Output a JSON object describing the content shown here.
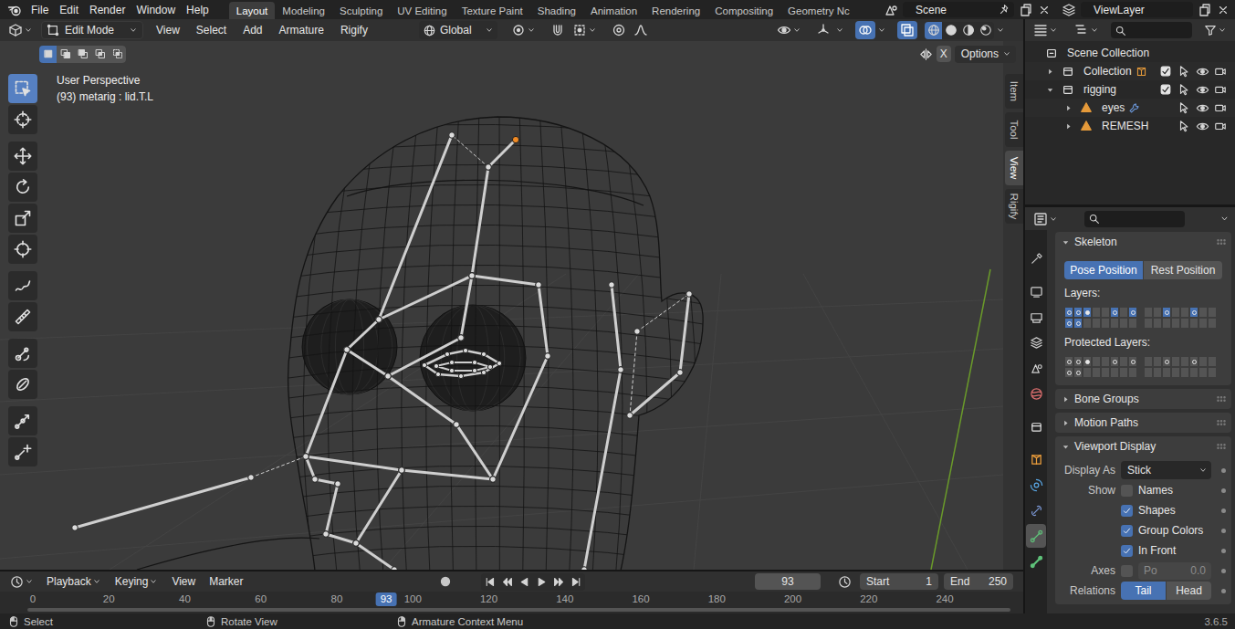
{
  "top_bar": {
    "menus": [
      "File",
      "Edit",
      "Render",
      "Window",
      "Help"
    ],
    "workspaces": [
      {
        "label": "Layout",
        "selected": true
      },
      {
        "label": "Modeling",
        "selected": false
      },
      {
        "label": "Sculpting",
        "selected": false
      },
      {
        "label": "UV Editing",
        "selected": false
      },
      {
        "label": "Texture Paint",
        "selected": false
      },
      {
        "label": "Shading",
        "selected": false
      },
      {
        "label": "Animation",
        "selected": false
      },
      {
        "label": "Rendering",
        "selected": false
      },
      {
        "label": "Compositing",
        "selected": false
      },
      {
        "label": "Geometry Nc",
        "selected": false
      }
    ],
    "scene": "Scene",
    "view_layer": "ViewLayer"
  },
  "viewport": {
    "mode": "Edit Mode",
    "menus": [
      "View",
      "Select",
      "Add",
      "Armature",
      "Rigify"
    ],
    "orientation": "Global",
    "snap": false,
    "proportional": false,
    "gizmos": false,
    "overlays": true,
    "xray": true,
    "shading": [
      {
        "kind": "wireframe",
        "selected": true
      },
      {
        "kind": "solid",
        "selected": false
      },
      {
        "kind": "material",
        "selected": false
      },
      {
        "kind": "rendered",
        "selected": false
      }
    ],
    "select_modes": [
      {
        "kind": "set",
        "selected": true
      },
      {
        "kind": "extend",
        "selected": false
      },
      {
        "kind": "subtract",
        "selected": false
      },
      {
        "kind": "difference",
        "selected": false
      },
      {
        "kind": "intersect",
        "selected": false
      }
    ],
    "mirror_axis": {
      "label": "X",
      "on": false
    },
    "options": "Options",
    "info": [
      "User Perspective",
      "(93) metarig : lid.T.L"
    ],
    "tools": [
      [
        {
          "kind": "select",
          "selected": true
        },
        {
          "kind": "cursor",
          "selected": false
        }
      ],
      [
        {
          "kind": "move",
          "selected": false
        },
        {
          "kind": "rotate",
          "selected": false
        },
        {
          "kind": "scale",
          "selected": false
        },
        {
          "kind": "transform",
          "selected": false
        }
      ],
      [
        {
          "kind": "annotate",
          "selected": false
        },
        {
          "kind": "measure",
          "selected": false
        }
      ],
      [
        {
          "kind": "roll",
          "selected": false
        },
        {
          "kind": "envelope",
          "selected": false
        }
      ],
      [
        {
          "kind": "extrude",
          "selected": false
        },
        {
          "kind": "extrudecursor",
          "selected": false
        }
      ]
    ],
    "side_tabs": [
      {
        "label": "Item",
        "selected": false
      },
      {
        "label": "Tool",
        "selected": false
      },
      {
        "label": "View",
        "selected": true
      },
      {
        "label": "Rigify",
        "selected": false
      }
    ]
  },
  "outliner": {
    "items": [
      {
        "label": "Scene Collection",
        "depth": 0,
        "kind": "scenecollection",
        "expandable": false
      },
      {
        "label": "Collection",
        "depth": 1,
        "kind": "collection",
        "expandable": true,
        "expanded": false,
        "checked": true,
        "selectable": true,
        "visible": true,
        "renderable": true,
        "child_kind": "object"
      },
      {
        "label": "rigging",
        "depth": 1,
        "kind": "collection",
        "expandable": true,
        "expanded": true,
        "checked": true,
        "selectable": true,
        "visible": true,
        "renderable": true,
        "child_kind": "none"
      },
      {
        "label": "eyes",
        "depth": 2,
        "kind": "mesh",
        "expandable": true,
        "expanded": false,
        "selectable": true,
        "visible": true,
        "renderable": true,
        "child_kind": "modifier"
      },
      {
        "label": "REMESH",
        "depth": 2,
        "kind": "mesh",
        "expandable": true,
        "expanded": false,
        "selectable": true,
        "visible": true,
        "renderable": true,
        "child_kind": "none"
      }
    ]
  },
  "properties": {
    "tabs": [
      {
        "kind": "tool",
        "selected": false
      },
      {
        "kind": "render",
        "selected": false
      },
      {
        "kind": "output",
        "selected": false
      },
      {
        "kind": "viewlayer",
        "selected": false
      },
      {
        "kind": "scene",
        "selected": false
      },
      {
        "kind": "world",
        "selected": false
      },
      {
        "kind": "collection",
        "selected": false
      },
      {
        "kind": "object",
        "selected": false
      },
      {
        "kind": "physics",
        "selected": false
      },
      {
        "kind": "constraints",
        "selected": false
      },
      {
        "kind": "data",
        "selected": true
      },
      {
        "kind": "bone",
        "selected": false
      }
    ],
    "skeleton": {
      "title": "Skeleton",
      "expanded": true,
      "positions": [
        {
          "label": "Pose Position",
          "selected": true
        },
        {
          "label": "Rest Position",
          "selected": false
        }
      ],
      "layers_label": "Layers:",
      "layers": [
        {
          "visible": true,
          "bones": true,
          "active": false
        },
        {
          "visible": true,
          "bones": true,
          "active": false
        },
        {
          "visible": true,
          "bones": true,
          "active": true
        },
        {
          "visible": false,
          "bones": false,
          "active": false
        },
        {
          "visible": false,
          "bones": false,
          "active": false
        },
        {
          "visible": true,
          "bones": true,
          "active": false
        },
        {
          "visible": false,
          "bones": false,
          "active": false
        },
        {
          "visible": true,
          "bones": true,
          "active": false
        },
        {
          "visible": false,
          "bones": false,
          "active": false
        },
        {
          "visible": false,
          "bones": false,
          "active": false
        },
        {
          "visible": true,
          "bones": true,
          "active": false
        },
        {
          "visible": false,
          "bones": false,
          "active": false
        },
        {
          "visible": false,
          "bones": false,
          "active": false
        },
        {
          "visible": true,
          "bones": true,
          "active": false
        },
        {
          "visible": false,
          "bones": false,
          "active": false
        },
        {
          "visible": false,
          "bones": false,
          "active": false
        },
        {
          "visible": true,
          "bones": true,
          "active": false
        },
        {
          "visible": true,
          "bones": true,
          "active": false
        },
        {
          "visible": false,
          "bones": false,
          "active": false
        },
        {
          "visible": false,
          "bones": false,
          "active": false
        },
        {
          "visible": false,
          "bones": false,
          "active": false
        },
        {
          "visible": false,
          "bones": false,
          "active": false
        },
        {
          "visible": false,
          "bones": false,
          "active": false
        },
        {
          "visible": false,
          "bones": false,
          "active": false
        },
        {
          "visible": false,
          "bones": false,
          "active": false
        },
        {
          "visible": false,
          "bones": false,
          "active": false
        },
        {
          "visible": false,
          "bones": false,
          "active": false
        },
        {
          "visible": false,
          "bones": false,
          "active": false
        },
        {
          "visible": false,
          "bones": false,
          "active": false
        },
        {
          "visible": false,
          "bones": false,
          "active": false
        },
        {
          "visible": false,
          "bones": false,
          "active": false
        },
        {
          "visible": false,
          "bones": false,
          "active": false
        }
      ],
      "protected_label": "Protected Layers:",
      "protected_layers": [
        {
          "protected": false,
          "bones": true,
          "active": false
        },
        {
          "protected": false,
          "bones": true,
          "active": false
        },
        {
          "protected": false,
          "bones": true,
          "active": true
        },
        {
          "protected": false,
          "bones": false,
          "active": false
        },
        {
          "protected": false,
          "bones": false,
          "active": false
        },
        {
          "protected": false,
          "bones": true,
          "active": false
        },
        {
          "protected": false,
          "bones": false,
          "active": false
        },
        {
          "protected": false,
          "bones": true,
          "active": false
        },
        {
          "protected": false,
          "bones": false,
          "active": false
        },
        {
          "protected": false,
          "bones": false,
          "active": false
        },
        {
          "protected": false,
          "bones": true,
          "active": false
        },
        {
          "protected": false,
          "bones": false,
          "active": false
        },
        {
          "protected": false,
          "bones": false,
          "active": false
        },
        {
          "protected": false,
          "bones": true,
          "active": false
        },
        {
          "protected": false,
          "bones": false,
          "active": false
        },
        {
          "protected": false,
          "bones": false,
          "active": false
        },
        {
          "protected": false,
          "bones": true,
          "active": false
        },
        {
          "protected": false,
          "bones": true,
          "active": false
        },
        {
          "protected": false,
          "bones": false,
          "active": false
        },
        {
          "protected": false,
          "bones": false,
          "active": false
        },
        {
          "protected": false,
          "bones": false,
          "active": false
        },
        {
          "protected": false,
          "bones": false,
          "active": false
        },
        {
          "protected": false,
          "bones": false,
          "active": false
        },
        {
          "protected": false,
          "bones": false,
          "active": false
        },
        {
          "protected": false,
          "bones": false,
          "active": false
        },
        {
          "protected": false,
          "bones": false,
          "active": false
        },
        {
          "protected": false,
          "bones": false,
          "active": false
        },
        {
          "protected": false,
          "bones": false,
          "active": false
        },
        {
          "protected": false,
          "bones": false,
          "active": false
        },
        {
          "protected": false,
          "bones": false,
          "active": false
        },
        {
          "protected": false,
          "bones": false,
          "active": false
        },
        {
          "protected": false,
          "bones": false,
          "active": false
        }
      ]
    },
    "collapsed_panels": [
      {
        "title": "Bone Groups",
        "expanded": false
      },
      {
        "title": "Motion Paths",
        "expanded": false
      }
    ],
    "viewport_display": {
      "title": "Viewport Display",
      "expanded": true,
      "display_as": {
        "label": "Display As",
        "value": "Stick"
      },
      "show_label": "Show",
      "show": [
        {
          "label": "Names",
          "checked": false
        },
        {
          "label": "Shapes",
          "checked": true
        },
        {
          "label": "Group Colors",
          "checked": true
        },
        {
          "label": "In Front",
          "checked": true
        }
      ],
      "axes": {
        "label": "Axes",
        "checked": false,
        "field_label": "Po",
        "field_value": "0.0"
      },
      "relations": {
        "label": "Relations",
        "options": [
          {
            "label": "Tail",
            "selected": true
          },
          {
            "label": "Head",
            "selected": false
          }
        ]
      }
    }
  },
  "timeline": {
    "menus": [
      {
        "label": "Playback",
        "kind": "dropdown"
      },
      {
        "label": "Keying",
        "kind": "dropdown"
      },
      {
        "label": "View",
        "kind": "menu"
      },
      {
        "label": "Marker",
        "kind": "menu"
      }
    ],
    "auto_keying": false,
    "transport": [
      {
        "kind": "jumpstart"
      },
      {
        "kind": "prevkey"
      },
      {
        "kind": "reverse"
      },
      {
        "kind": "play"
      },
      {
        "kind": "nextkey"
      },
      {
        "kind": "jumpend"
      }
    ],
    "current_frame": "93",
    "preview_range": false,
    "start": {
      "label": "Start",
      "value": "1"
    },
    "end": {
      "label": "End",
      "value": "250"
    },
    "ruler": [
      "0",
      "20",
      "40",
      "60",
      "80",
      "100",
      "120",
      "140",
      "160",
      "180",
      "200",
      "220",
      "240"
    ],
    "playhead": "93"
  },
  "status_bar": {
    "items": [
      {
        "label": "Select",
        "kind": "left"
      },
      {
        "label": "Rotate View",
        "kind": "middle"
      },
      {
        "label": "Armature Context Menu",
        "kind": "right"
      }
    ],
    "version": "3.6.5"
  }
}
